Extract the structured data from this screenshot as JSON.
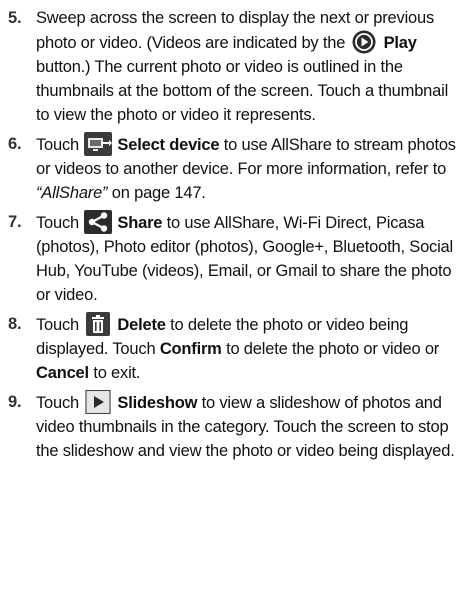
{
  "steps": [
    {
      "number": "5.",
      "text1": "Sweep across the screen to display the next or previous photo or video. (Videos are indicated by the",
      "icon": "play-circle-icon",
      "label": "Play",
      "text2": "button.) The current photo or video is outlined in the thumbnails at the bottom of the screen. Touch a thumbnail to view the photo or video it represents."
    },
    {
      "number": "6.",
      "text1": "Touch",
      "icon": "select-device-icon",
      "label": "Select device",
      "text2": "to use AllShare to stream photos or videos to another device. For more information, refer to",
      "ref": "“AllShare”",
      "text3": "on page 147."
    },
    {
      "number": "7.",
      "text1": "Touch",
      "icon": "share-icon",
      "label": "Share",
      "text2": "to use AllShare, Wi-Fi Direct, Picasa (photos), Photo editor (photos), Google+, Bluetooth, Social Hub, YouTube (videos), Email, or Gmail to share the photo or video."
    },
    {
      "number": "8.",
      "text1": "Touch",
      "icon": "trash-icon",
      "label": "Delete",
      "text2": "to delete the photo or video being displayed. Touch",
      "label2": "Confirm",
      "text3": "to delete the photo or video or",
      "label3": "Cancel",
      "text4": "to exit."
    },
    {
      "number": "9.",
      "text1": "Touch",
      "icon": "slideshow-icon",
      "label": "Slideshow",
      "text2": "to view a slideshow of photos and video thumbnails in the category. Touch the screen to stop the slideshow and view the photo or video being displayed."
    }
  ]
}
